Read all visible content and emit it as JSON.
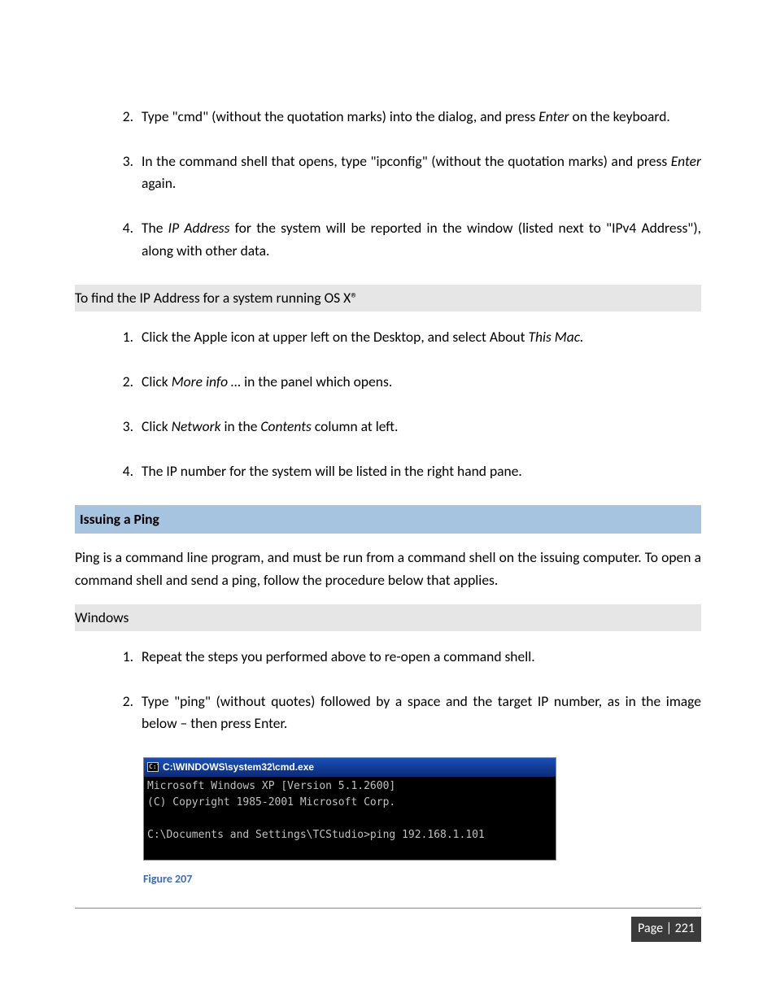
{
  "list1": {
    "i2": {
      "num": "2.",
      "t1": "Type \"cmd\" (without the quotation marks) into the dialog, and press ",
      "em": "Enter",
      "t2": " on the keyboard."
    },
    "i3": {
      "num": "3.",
      "t1": "In the command shell that opens, type \"ipconfig\" (without the quotation marks) and press ",
      "em": "Enter",
      "t2": " again."
    },
    "i4": {
      "num": "4.",
      "t1": "The ",
      "em": "IP Address",
      "t2": " for the system will be reported in the window (listed next to \"IPv4 Address\"), along with other data."
    }
  },
  "osx_heading": "To find the IP Address for a system running OS X®",
  "list2": {
    "i1": {
      "num": "1.",
      "t1": "Click the Apple icon at upper left on the Desktop, and select About ",
      "em": "This Mac.",
      "t2": ""
    },
    "i2": {
      "num": "2.",
      "t1": "Click ",
      "em": "More info …",
      "t2": " in the panel which opens."
    },
    "i3": {
      "num": "3.",
      "t1": "Click ",
      "em1": "Network",
      "mid": " in the ",
      "em2": "Contents",
      "t2": " column at left."
    },
    "i4": {
      "num": "4.",
      "text": "The IP number for the system will be listed in the right hand pane."
    }
  },
  "ping_heading": "Issuing a Ping",
  "ping_body": "Ping is a command line program, and must be run from a command shell on the issuing computer. To open a command shell and send a ping, follow the procedure below that applies.",
  "windows_heading": "Windows",
  "list3": {
    "i1": {
      "num": "1.",
      "text": "Repeat the steps you performed above to re-open a command shell."
    },
    "i2": {
      "num": "2.",
      "text": "Type \"ping\" (without quotes) followed by a space and the target IP number, as in the image below – then press Enter."
    }
  },
  "cmd": {
    "icon_glyph": "C:\\",
    "title": "C:\\WINDOWS\\system32\\cmd.exe",
    "line1": "Microsoft Windows XP [Version 5.1.2600]",
    "line2": "(C) Copyright 1985-2001 Microsoft Corp.",
    "line3": "C:\\Documents and Settings\\TCStudio>ping 192.168.1.101"
  },
  "figure_caption": "Figure 207",
  "footer": {
    "label": "Page | ",
    "num": "221"
  }
}
